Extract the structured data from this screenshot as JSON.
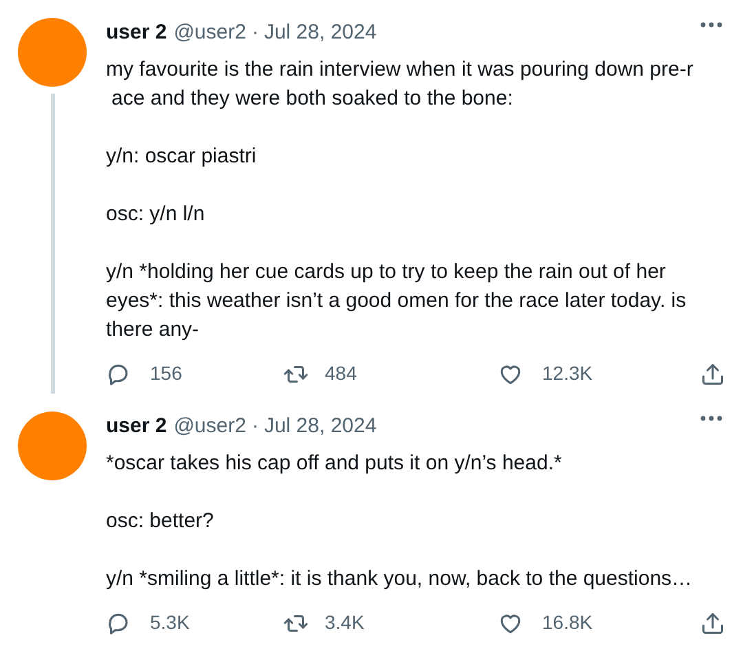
{
  "tweets": [
    {
      "author": {
        "name": "user 2",
        "handle": "@user2",
        "separator": "·",
        "date": "Jul 28, 2024"
      },
      "paragraphs": [
        [
          "my favourite is the rain interview when it was pouring down pre-r",
          "ace and they were both soaked to the bone:"
        ],
        [
          "y/n: oscar piastri"
        ],
        [
          "osc: y/n l/n"
        ],
        [
          "y/n *holding her cue cards up to try to keep the rain out of her eyes*: this weather isn’t a good omen for the race later today. is there any-"
        ]
      ],
      "stats": {
        "replies": "156",
        "retweets": "484",
        "likes": "12.3K"
      }
    },
    {
      "author": {
        "name": "user 2",
        "handle": "@user2",
        "separator": "·",
        "date": "Jul 28, 2024"
      },
      "paragraphs": [
        [
          "*oscar takes his cap off and puts it on y/n’s head.*"
        ],
        [
          "osc: better?"
        ],
        [
          "y/n *smiling a little*: it is thank you, now, back to the questions…"
        ]
      ],
      "stats": {
        "replies": "5.3K",
        "retweets": "3.4K",
        "likes": "16.8K"
      }
    }
  ]
}
